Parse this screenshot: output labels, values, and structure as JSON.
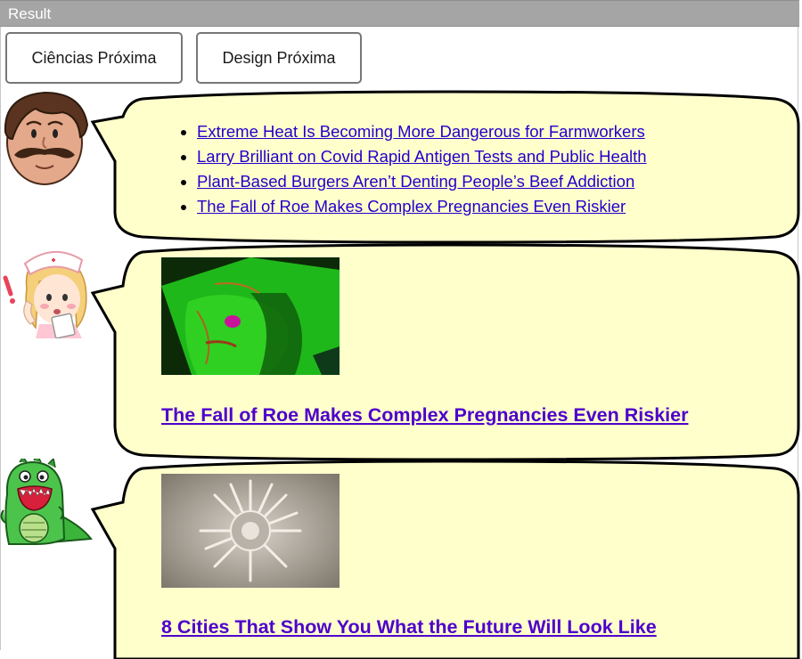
{
  "window": {
    "title": "Result"
  },
  "nav": {
    "buttons": [
      {
        "label": "Ciências Próxima"
      },
      {
        "label": "Design Próxima"
      }
    ]
  },
  "bubbles": [
    {
      "avatar": "mustache-man-avatar",
      "links": [
        "Extreme Heat Is Becoming More Dangerous for Farmworkers",
        "Larry Brilliant on Covid Rapid Antigen Tests and Public Health",
        "Plant-Based Burgers Aren’t Denting People’s Beef Addiction",
        "The Fall of Roe Makes Complex Pregnancies Even Riskier"
      ]
    },
    {
      "avatar": "nurse-avatar",
      "image": "ultrasound-scan-image",
      "headline": "The Fall of Roe Makes Complex Pregnancies Even Riskier"
    },
    {
      "avatar": "green-dinosaur-avatar",
      "image": "futuristic-city-model-image",
      "headline": "8 Cities That Show You What the Future Will Look Like"
    }
  ],
  "colors": {
    "bubble_fill": "#ffffcc",
    "bubble_stroke": "#000000",
    "link": "#2200cc",
    "headline": "#4d00cc",
    "titlebar": "#a5a5a5"
  }
}
